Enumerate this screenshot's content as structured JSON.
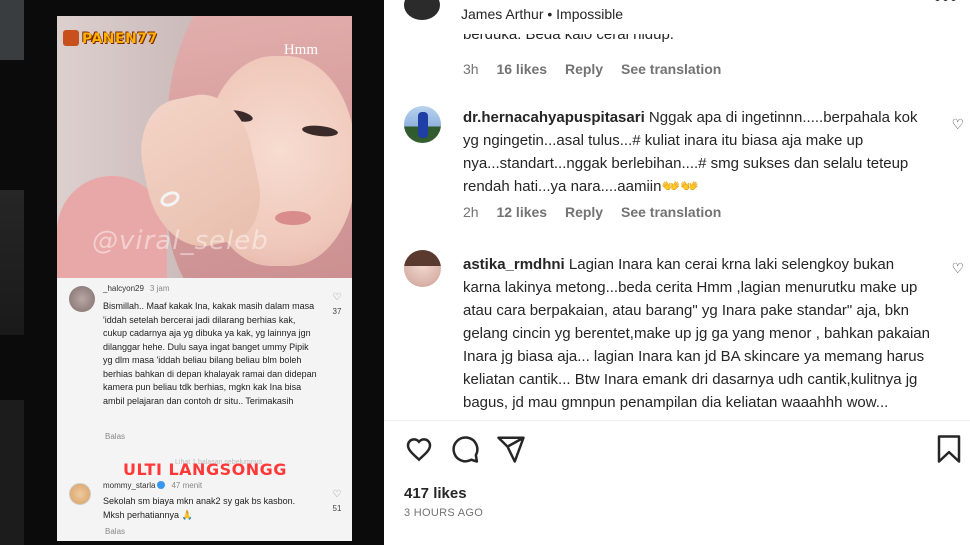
{
  "left_panel": {
    "overlay": {
      "logo": "PANEN77",
      "hmm": "Hmm",
      "watermark": "@viral_seleb"
    },
    "comment_1": {
      "username": "_halcyon29",
      "time": "3 jam",
      "text": "Bismillah.. Maaf kakak Ina, kakak masih dalam masa 'iddah setelah bercerai jadi dilarang berhias kak, cukup cadarnya aja yg dibuka ya kak, yg lainnya jgn dilanggar hehe. Dulu saya ingat banget ummy Pipik yg dlm masa 'iddah beliau bilang beliau blm boleh berhias bahkan di depan khalayak ramai dan didepan kamera pun beliau tdk berhias, mgkn kak Ina bisa ambil pelajaran dan contoh dr situ.. Terimakasih",
      "reply": "Balas",
      "likes": "37"
    },
    "banner": "ULTI LANGSONGG",
    "faint_text": "Lihat 1 balasan sebelumnya",
    "comment_2": {
      "username": "mommy_starla",
      "time": "47 menit",
      "text": "Sekolah sm biaya mkn anak2 sy gak bs kasbon. Mksh perhatiannya 🙏",
      "reply": "Balas",
      "likes": "51"
    }
  },
  "post": {
    "song": "James Arthur • Impossible",
    "cut_text": "berduka. Beda kalo cerai hidup.",
    "top_meta": {
      "time": "3h",
      "likes": "16 likes",
      "reply": "Reply",
      "translate": "See translation"
    },
    "comments": [
      {
        "username": "dr.hernacahyapuspitasari",
        "text": "Nggak apa di ingetinnn.....berpahala kok yg ngingetin...asal tulus...# kuliat inara itu biasa aja make up nya...standart...nggak berlebihan....# smg sukses dan selalu teteup rendah hati...ya nara....aamiin👐👐",
        "time": "2h",
        "likes": "12 likes",
        "reply": "Reply",
        "translate": "See translation"
      },
      {
        "username": "astika_rmdhni",
        "text": "Lagian Inara kan cerai krna laki selengkoy bukan karna lakinya metong...beda cerita Hmm ,lagian menurutku make up atau cara berpakaian, atau barang\" yg Inara pake standar\" aja, bkn gelang cincin yg berentet,make up jg ga yang menor , bahkan pakaian Inara jg biasa aja... lagian Inara kan jd BA skincare ya memang harus keliatan cantik... Btw Inara emank dri dasarnya udh cantik,kulitnya jg bagus, jd mau gmnpun penampilan dia keliatan waaahhh wow... Wkwkwk"
      }
    ],
    "likes_total": "417 likes",
    "posted_ago": "3 HOURS AGO"
  },
  "icons": {
    "heart": "heart-icon",
    "comment": "comment-icon",
    "share": "share-icon",
    "save": "bookmark-icon",
    "more": "more-icon"
  }
}
